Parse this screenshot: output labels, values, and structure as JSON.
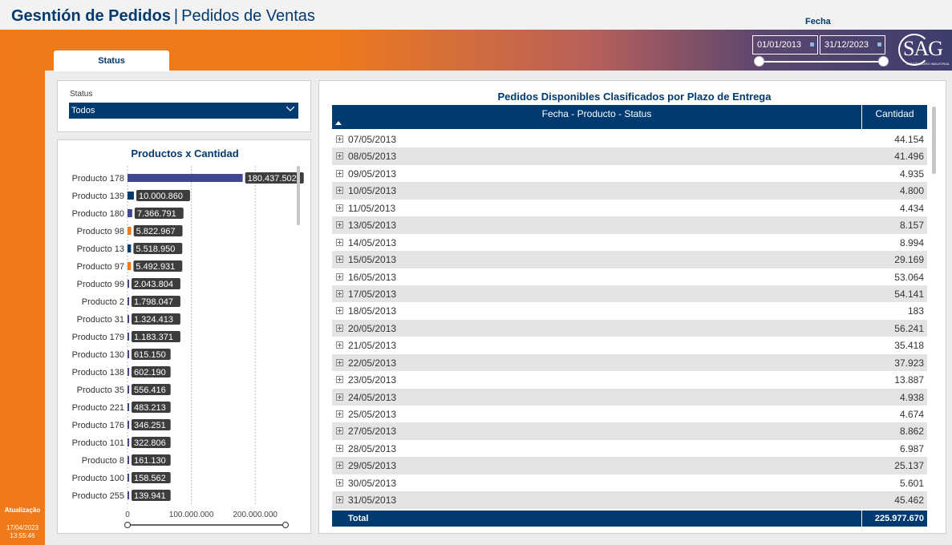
{
  "header": {
    "title_main": "Gesntión de Pedidos",
    "title_sep": "|",
    "title_sub": "Pedidos de Ventas",
    "tab_label": "Status"
  },
  "date_filter": {
    "label": "Fecha",
    "start": "01/01/2013",
    "end": "31/12/2023"
  },
  "logo": {
    "text": "SAG",
    "sub": "GESTÃO AGRO INDUSTRIAL"
  },
  "update": {
    "label": "Atualização",
    "date": "17/04/2023",
    "time": "13:55:46"
  },
  "status_filter": {
    "label": "Status",
    "value": "Todos"
  },
  "bar_chart": {
    "title": "Productos x Cantidad",
    "colors": {
      "navy": "#003a70",
      "blue": "#3f4794",
      "orange": "#ef7a17",
      "label_bg": "#3d3d3d"
    }
  },
  "chart_data": {
    "type": "bar",
    "orientation": "horizontal",
    "title": "Productos x Cantidad",
    "categories": [
      "Producto 178",
      "Producto 139",
      "Producto 180",
      "Producto 98",
      "Producto 13",
      "Producto 97",
      "Producto 99",
      "Producto 2",
      "Producto 31",
      "Producto 179",
      "Producto 130",
      "Producto 138",
      "Producto 35",
      "Producto 221",
      "Producto 176",
      "Producto 101",
      "Producto 8",
      "Producto 100",
      "Producto 255"
    ],
    "values": [
      180437502,
      10000860,
      7366791,
      5822967,
      5518950,
      5492931,
      2043804,
      1798047,
      1324413,
      1183371,
      615150,
      602190,
      556416,
      483213,
      346251,
      322806,
      161130,
      158562,
      139941
    ],
    "value_labels": [
      "180.437.502",
      "10.000.860",
      "7.366.791",
      "5.822.967",
      "5.518.950",
      "5.492.931",
      "2.043.804",
      "1.798.047",
      "1.324.413",
      "1.183.371",
      "615.150",
      "602.190",
      "556.416",
      "483.213",
      "346.251",
      "322.806",
      "161.130",
      "158.562",
      "139.941"
    ],
    "bar_colors": [
      "#3f4794",
      "#003a70",
      "#3f4794",
      "#ef7a17",
      "#003a70",
      "#ef7a17",
      "#3f4794",
      "#3f4794",
      "#3f4794",
      "#3f4794",
      "#3f4794",
      "#3f4794",
      "#3f4794",
      "#3f4794",
      "#3f4794",
      "#3f4794",
      "#3f4794",
      "#3f4794",
      "#3f4794"
    ],
    "xlim": [
      0,
      250000000
    ],
    "x_ticks": [
      0,
      100000000,
      200000000
    ],
    "x_tick_labels": [
      "0",
      "100.000.000",
      "200.000.000"
    ],
    "grid": true
  },
  "table": {
    "title": "Pedidos Disponibles Clasificados por Plazo de Entrega",
    "col1": "Fecha - Producto - Status",
    "col2": "Cantidad",
    "rows": [
      {
        "date": "07/05/2013",
        "qty": "44.154"
      },
      {
        "date": "08/05/2013",
        "qty": "41.496"
      },
      {
        "date": "09/05/2013",
        "qty": "4.935"
      },
      {
        "date": "10/05/2013",
        "qty": "4.800"
      },
      {
        "date": "11/05/2013",
        "qty": "4.434"
      },
      {
        "date": "13/05/2013",
        "qty": "8.157"
      },
      {
        "date": "14/05/2013",
        "qty": "8.994"
      },
      {
        "date": "15/05/2013",
        "qty": "29.169"
      },
      {
        "date": "16/05/2013",
        "qty": "53.064"
      },
      {
        "date": "17/05/2013",
        "qty": "54.141"
      },
      {
        "date": "18/05/2013",
        "qty": "183"
      },
      {
        "date": "20/05/2013",
        "qty": "56.241"
      },
      {
        "date": "21/05/2013",
        "qty": "35.418"
      },
      {
        "date": "22/05/2013",
        "qty": "37.923"
      },
      {
        "date": "23/05/2013",
        "qty": "13.887"
      },
      {
        "date": "24/05/2013",
        "qty": "4.938"
      },
      {
        "date": "25/05/2013",
        "qty": "4.674"
      },
      {
        "date": "27/05/2013",
        "qty": "8.862"
      },
      {
        "date": "28/05/2013",
        "qty": "6.987"
      },
      {
        "date": "29/05/2013",
        "qty": "25.137"
      },
      {
        "date": "30/05/2013",
        "qty": "5.601"
      },
      {
        "date": "31/05/2013",
        "qty": "45.462"
      }
    ],
    "total_label": "Total",
    "total_value": "225.977.670"
  }
}
